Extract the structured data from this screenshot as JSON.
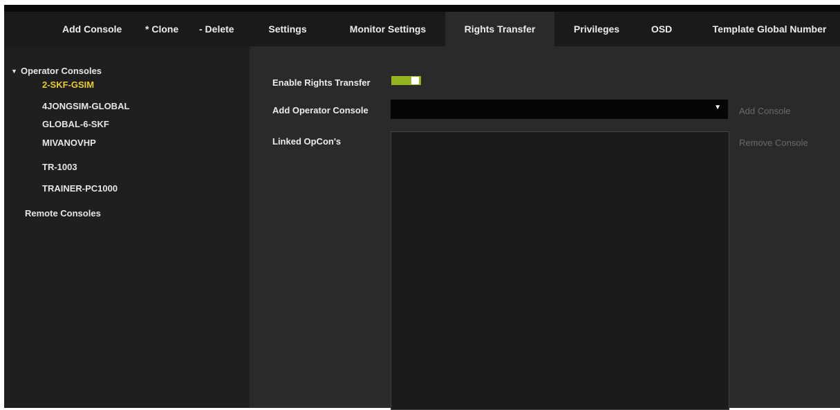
{
  "toolbar": {
    "add_console": "Add Console",
    "clone": "* Clone",
    "delete": "- Delete"
  },
  "tabs": [
    {
      "label": "Settings"
    },
    {
      "label": "Monitor Settings"
    },
    {
      "label": "Rights Transfer",
      "active": true
    },
    {
      "label": "Privileges"
    },
    {
      "label": "OSD"
    },
    {
      "label": "Template Global Number"
    }
  ],
  "tree": {
    "operator_consoles": {
      "label": "Operator Consoles",
      "expanded_icon": "triangle-down-icon",
      "items": [
        {
          "label": "2-SKF-GSIM",
          "selected": true
        },
        {
          "label": "4JONGSIM-GLOBAL"
        },
        {
          "label": "GLOBAL-6-SKF"
        },
        {
          "label": "MIVANOVHP"
        },
        {
          "label": "TR-1003"
        },
        {
          "label": "TRAINER-PC1000"
        }
      ]
    },
    "remote_consoles": {
      "label": "Remote Consoles"
    }
  },
  "rights_transfer": {
    "enable_label": "Enable Rights Transfer",
    "enable_value": true,
    "add_operator_label": "Add Operator Console",
    "add_operator_value": "",
    "add_console_button": "Add Console",
    "linked_label": "Linked OpCon's",
    "remove_console_button": "Remove Console"
  },
  "colors": {
    "selected_text": "#e8cc2c",
    "toggle_on": "#93b41c",
    "disabled_text": "#6a6a6a"
  }
}
